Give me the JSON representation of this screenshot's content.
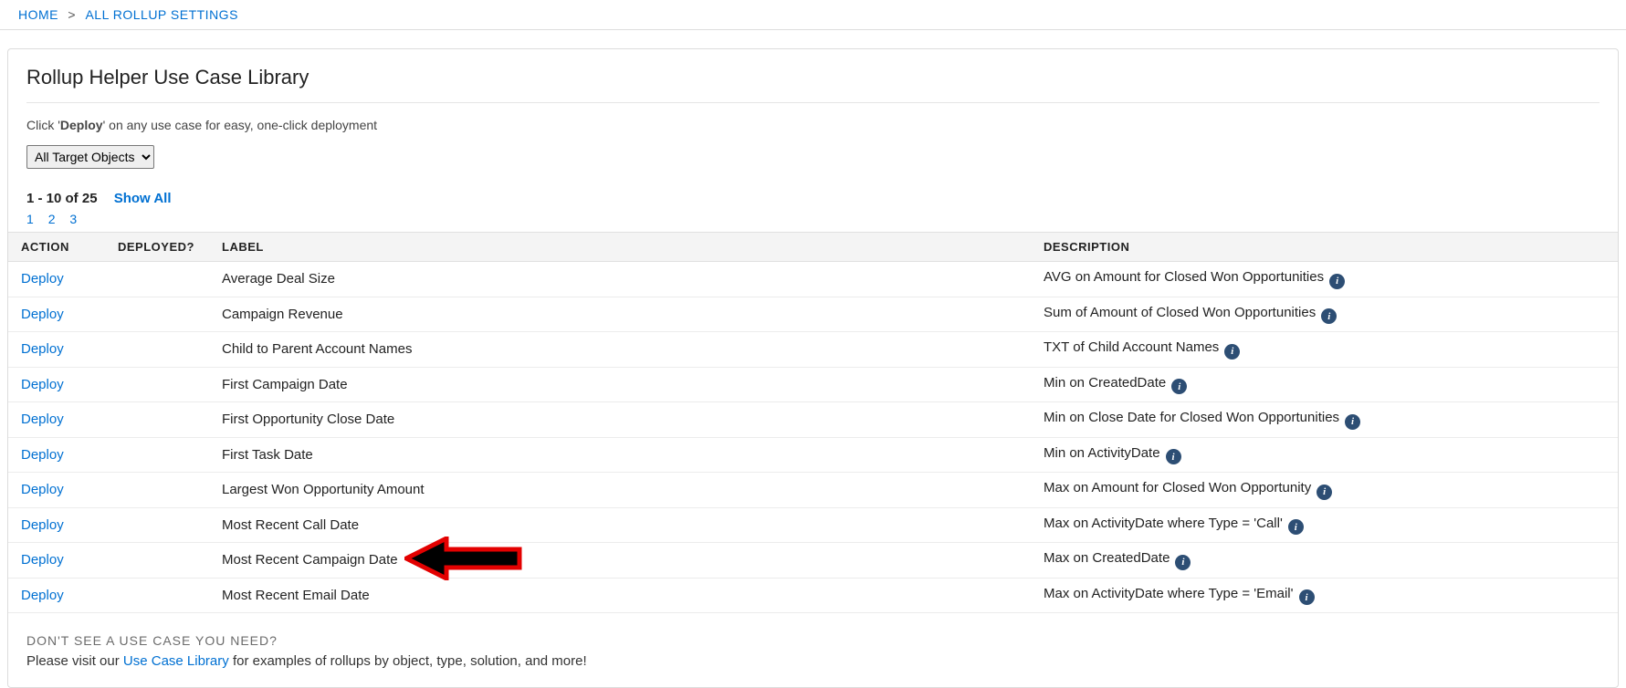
{
  "breadcrumb": {
    "home": "HOME",
    "current": "ALL ROLLUP SETTINGS",
    "sep": ">"
  },
  "page_title": "Rollup Helper Use Case Library",
  "instruction": {
    "pre": "Click '",
    "bold": "Deploy",
    "post": "' on any use case for easy, one-click deployment"
  },
  "filter": {
    "selected": "All Target Objects"
  },
  "pagination": {
    "range": "1 - 10 of 25",
    "show_all": "Show All",
    "pages": [
      "1",
      "2",
      "3"
    ]
  },
  "columns": {
    "action": "ACTION",
    "deployed": "DEPLOYED?",
    "label": "LABEL",
    "description": "DESCRIPTION"
  },
  "deploy_label": "Deploy",
  "rows": [
    {
      "label": "Average Deal Size",
      "desc": "AVG on Amount for Closed Won Opportunities"
    },
    {
      "label": "Campaign Revenue",
      "desc": "Sum of Amount of Closed Won Opportunities"
    },
    {
      "label": "Child to Parent Account Names",
      "desc": "TXT of Child Account Names"
    },
    {
      "label": "First Campaign Date",
      "desc": "Min on CreatedDate"
    },
    {
      "label": "First Opportunity Close Date",
      "desc": "Min on Close Date for Closed Won Opportunities"
    },
    {
      "label": "First Task Date",
      "desc": "Min on ActivityDate"
    },
    {
      "label": "Largest Won Opportunity Amount",
      "desc": "Max on Amount for Closed Won Opportunity"
    },
    {
      "label": "Most Recent Call Date",
      "desc": "Max on ActivityDate where Type = 'Call'"
    },
    {
      "label": "Most Recent Campaign Date",
      "desc": "Max on CreatedDate"
    },
    {
      "label": "Most Recent Email Date",
      "desc": "Max on ActivityDate where Type = 'Email'"
    }
  ],
  "footer": {
    "heading": "DON'T SEE A USE CASE YOU NEED?",
    "text_pre": "Please visit our ",
    "link": "Use Case Library",
    "text_post": " for examples of rollups by object, type, solution, and more!"
  },
  "annotation_row_index": 8
}
